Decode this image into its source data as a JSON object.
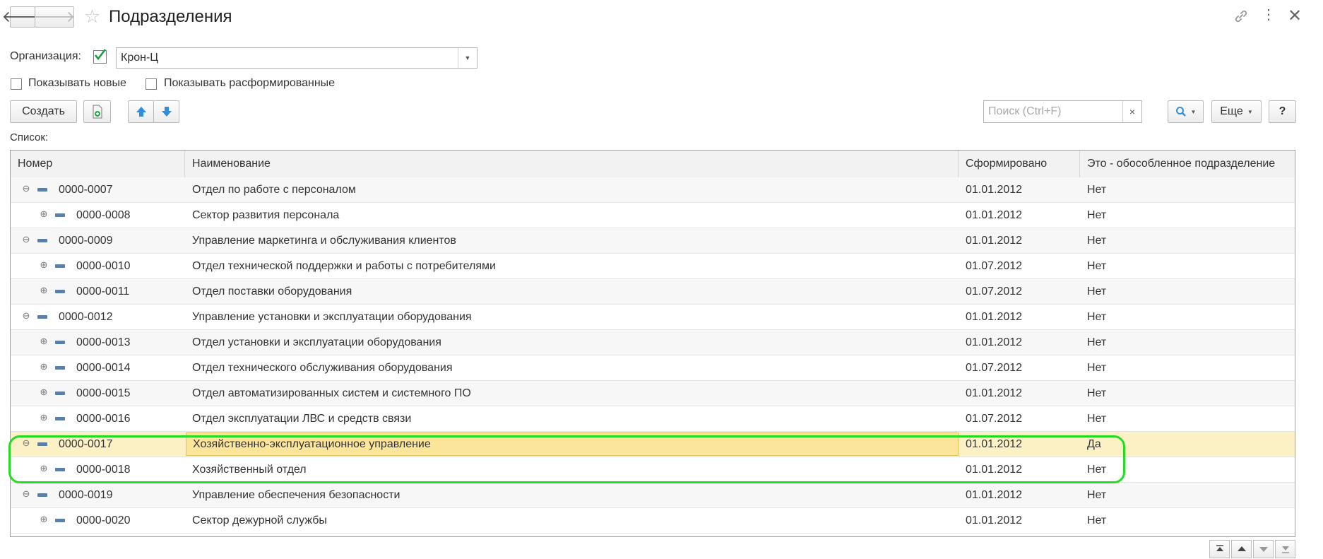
{
  "header": {
    "back_icon": "arrow-left-icon",
    "forward_icon": "arrow-right-icon",
    "favorite_icon": "star-icon",
    "title": "Подразделения",
    "link_icon": "link-icon",
    "more_icon": "vertical-dots-icon",
    "close_icon": "close-icon"
  },
  "filter": {
    "org_label": "Организация:",
    "org_checked": true,
    "org_value": "Крон-Ц",
    "show_new_label": "Показывать новые",
    "show_disbanded_label": "Показывать расформированные"
  },
  "toolbar": {
    "create_label": "Создать",
    "search_placeholder": "Поиск (Ctrl+F)",
    "clear_label": "×",
    "more_label": "Еще",
    "help_label": "?"
  },
  "list_label": "Список:",
  "columns": [
    "Номер",
    "Наименование",
    "Сформировано",
    "Это - обособленное подразделение"
  ],
  "rows": [
    {
      "number": "0000-0007",
      "name": "Отдел по работе с персоналом",
      "formed": "01.01.2012",
      "separate": "Нет",
      "level": 0,
      "expander": "⊖"
    },
    {
      "number": "0000-0008",
      "name": "Сектор развития персонала",
      "formed": "01.01.2012",
      "separate": "Нет",
      "level": 1,
      "expander": "⊕"
    },
    {
      "number": "0000-0009",
      "name": "Управление маркетинга и обслуживания клиентов",
      "formed": "01.01.2012",
      "separate": "Нет",
      "level": 0,
      "expander": "⊖"
    },
    {
      "number": "0000-0010",
      "name": "Отдел технической поддержки и работы с потребителями",
      "formed": "01.07.2012",
      "separate": "Нет",
      "level": 1,
      "expander": "⊕"
    },
    {
      "number": "0000-0011",
      "name": "Отдел поставки оборудования",
      "formed": "01.07.2012",
      "separate": "Нет",
      "level": 1,
      "expander": "⊕"
    },
    {
      "number": "0000-0012",
      "name": "Управление установки и эксплуатации оборудования",
      "formed": "01.01.2012",
      "separate": "Нет",
      "level": 0,
      "expander": "⊖"
    },
    {
      "number": "0000-0013",
      "name": "Отдел установки и эксплуатации оборудования",
      "formed": "01.01.2012",
      "separate": "Нет",
      "level": 1,
      "expander": "⊕"
    },
    {
      "number": "0000-0014",
      "name": "Отдел технического обслуживания оборудования",
      "formed": "01.07.2012",
      "separate": "Нет",
      "level": 1,
      "expander": "⊕"
    },
    {
      "number": "0000-0015",
      "name": "Отдел автоматизированных систем и системного ПО",
      "formed": "01.01.2012",
      "separate": "Нет",
      "level": 1,
      "expander": "⊕"
    },
    {
      "number": "0000-0016",
      "name": "Отдел эксплуатации ЛВС и средств связи",
      "formed": "01.07.2012",
      "separate": "Нет",
      "level": 1,
      "expander": "⊕"
    },
    {
      "number": "0000-0017",
      "name": "Хозяйственно-эксплуатационное управление",
      "formed": "01.01.2012",
      "separate": "Да",
      "level": 0,
      "expander": "⊖",
      "selected": true
    },
    {
      "number": "0000-0018",
      "name": "Хозяйственный отдел",
      "formed": "01.01.2012",
      "separate": "Нет",
      "level": 1,
      "expander": "⊕"
    },
    {
      "number": "0000-0019",
      "name": "Управление обеспечения безопасности",
      "formed": "01.01.2012",
      "separate": "Нет",
      "level": 0,
      "expander": "⊖"
    },
    {
      "number": "0000-0020",
      "name": "Сектор дежурной службы",
      "formed": "01.01.2012",
      "separate": "Нет",
      "level": 1,
      "expander": "⊕"
    }
  ],
  "colors": {
    "accent_green": "#22dd22",
    "selected_row": "#fbf1c4",
    "selected_cell": "#fbe59a",
    "checkbox_green": "#1a9e3c"
  },
  "bottom_nav": [
    "first-icon",
    "up-icon",
    "down-icon",
    "last-icon"
  ]
}
